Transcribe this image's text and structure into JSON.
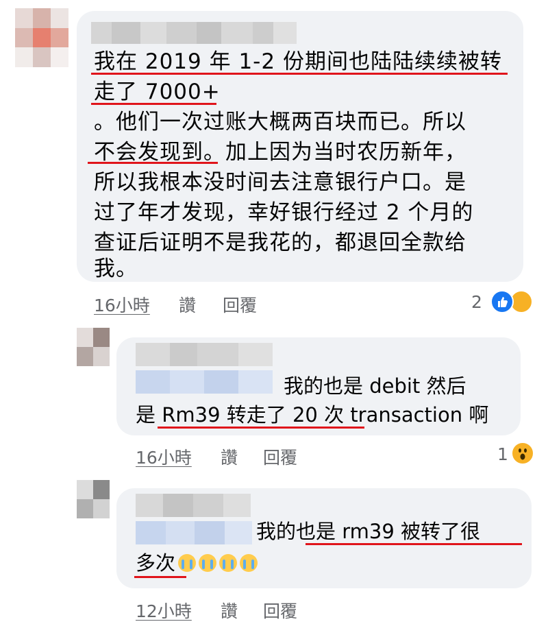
{
  "comment": {
    "lines": [
      "我在 2019 年 1-2 份期间也陆陆续续被转",
      "走了 7000+",
      "。他们一次过账大概两百块而已。所以",
      "不会发现到。加上因为当时农历新年，",
      "所以我根本没时间去注意银行户口。是",
      "过了年才发现，幸好银行经过 2 个月的",
      "查证后证明不是我花的，都退回全款给",
      "我。"
    ],
    "time": "16小時",
    "like_label": "讚",
    "reply_label": "回覆",
    "reaction_count": "2",
    "reaction_icons": [
      "like-icon",
      "care-icon"
    ]
  },
  "reply1": {
    "line1": "我的也是 debit 然后",
    "line2": "是 Rm39 转走了 20 次 transaction 啊",
    "time": "16小時",
    "like_label": "讚",
    "reply_label": "回覆",
    "reaction_count": "1",
    "reaction_icons": [
      "wow-icon"
    ]
  },
  "reply2": {
    "line1": "我的也是 rm39 被转了很",
    "line2": "多次",
    "emojis": [
      "loudly-crying-face",
      "loudly-crying-face",
      "loudly-crying-face",
      "loudly-crying-face"
    ],
    "time": "12小時",
    "like_label": "讚",
    "reply_label": "回覆"
  },
  "colors": {
    "bubble": "#f0f2f5",
    "underline": "#e0141b",
    "meta_text": "#65676b",
    "like_blue": "#1877f2",
    "emoji_yellow": "#f7b125"
  }
}
